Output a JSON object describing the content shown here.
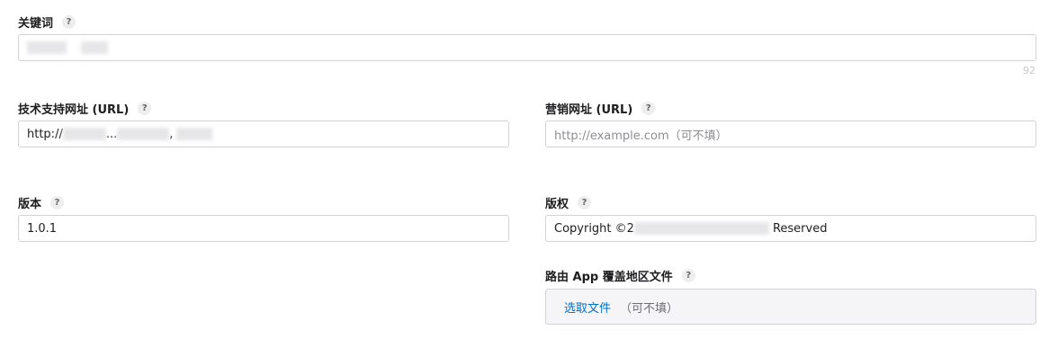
{
  "keywords": {
    "label": "关键词",
    "value": "",
    "counter": "92"
  },
  "support_url": {
    "label": "技术支持网址 (URL)",
    "value_prefix": "http://",
    "value_fragment": "...",
    "value_suffix": ","
  },
  "marketing_url": {
    "label": "营销网址 (URL)",
    "placeholder": "http://example.com（可不填）"
  },
  "version": {
    "label": "版本",
    "value": "1.0.1"
  },
  "copyright": {
    "label": "版权",
    "value_prefix": "Copyright ©2",
    "value_suffix": "Reserved"
  },
  "routing_file": {
    "label": "路由 App 覆盖地区文件",
    "choose_file": "选取文件",
    "hint": "（可不填）"
  },
  "help_icon_glyph": "?",
  "icons": [
    "help-icon"
  ],
  "colors": {
    "link": "#0070c9",
    "border": "#d2d2d7",
    "file_box_bg": "#f5f5f7"
  }
}
